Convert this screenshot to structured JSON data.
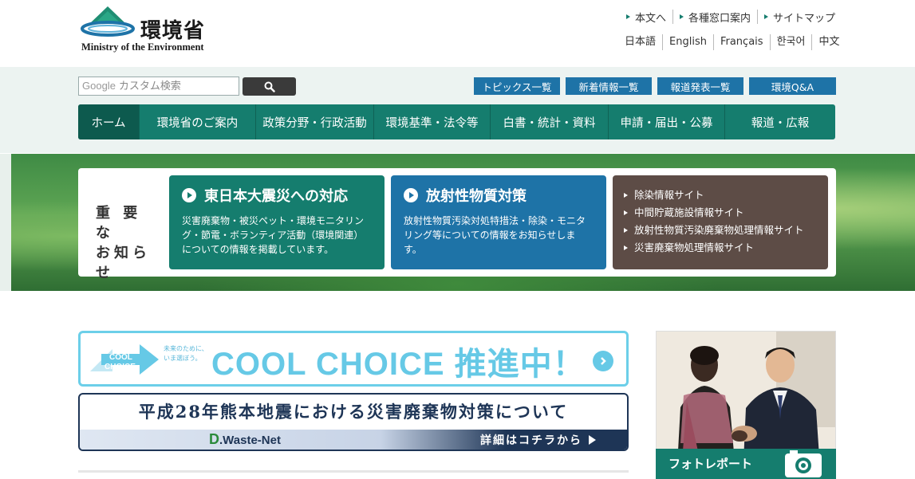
{
  "header": {
    "logo_jp": "環境省",
    "logo_en": "Ministry of the Environment",
    "util_links": [
      "本文へ",
      "各種窓口案内",
      "サイトマップ"
    ],
    "languages": [
      "日本語",
      "English",
      "Français",
      "한국어",
      "中文"
    ]
  },
  "search": {
    "brand": "Google",
    "placeholder": "カスタム検索"
  },
  "quick_links": [
    "トピックス一覧",
    "新着情報一覧",
    "報道発表一覧",
    "環境Q&A"
  ],
  "nav": [
    "ホーム",
    "環境省のご案内",
    "政策分野・行政活動",
    "環境基準・法令等",
    "白書・統計・資料",
    "申請・届出・公募",
    "報道・広報"
  ],
  "notice": {
    "label_line1": "重 要 な",
    "label_line2": "お知らせ",
    "card1": {
      "title": "東日本大震災への対応",
      "body": "災害廃棄物・被災ペット・環境モニタリング・節電・ボランティア活動（環境関連）についての情報を掲載しています。",
      "color": "#157d6e"
    },
    "card2": {
      "title": "放射性物質対策",
      "body": "放射性物質汚染対処特措法・除染・モニタリング等についての情報をお知らせします。",
      "color": "#1e73a7"
    },
    "card3": {
      "links": [
        "除染情報サイト",
        "中間貯蔵施設情報サイト",
        "放射性物質汚染廃棄物処理情報サイト",
        "災害廃棄物処理情報サイト"
      ],
      "color": "#5d4c46"
    }
  },
  "banners": {
    "cool_choice": {
      "logo_line1": "COOL",
      "logo_line2": "CHOICE",
      "tagline": "未来のために、いま選ぼう。",
      "headline": "COOL CHOICE 推進中！"
    },
    "waste": {
      "title": "平成28年熊本地震における災害廃棄物対策について",
      "logo_d": "D",
      "logo_rest": ".Waste-Net",
      "more": "詳細はコチラから"
    }
  },
  "photo_report": {
    "caption": "フォトレポート"
  },
  "colors": {
    "primary": "#157d6e",
    "accent_blue": "#1e73a7",
    "brown": "#5d4c46",
    "cool": "#66c9e6",
    "navy": "#1e3556"
  }
}
